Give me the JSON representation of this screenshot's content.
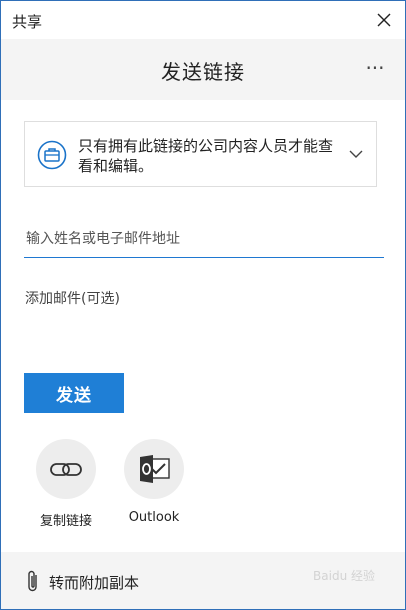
{
  "window": {
    "title": "共享"
  },
  "header": {
    "title": "发送链接",
    "more_label": "···"
  },
  "permission": {
    "text": "只有拥有此链接的公司内容人员才能查看和编辑。"
  },
  "recipient": {
    "placeholder": "输入姓名或电子邮件地址",
    "value": ""
  },
  "message": {
    "placeholder": "添加邮件(可选)",
    "value": ""
  },
  "send_button": {
    "label": "发送"
  },
  "actions": [
    {
      "label": "复制链接",
      "icon": "link-icon"
    },
    {
      "label": "Outlook",
      "icon": "outlook-icon"
    }
  ],
  "footer": {
    "label": "转而附加副本",
    "icon": "paperclip-icon"
  },
  "watermark": {
    "text": "Baidu 经验"
  },
  "colors": {
    "accent": "#1f7fd6",
    "header_bg": "#f4f4f4",
    "icon_blue": "#1a73c9",
    "circle_bg": "#ededed"
  }
}
